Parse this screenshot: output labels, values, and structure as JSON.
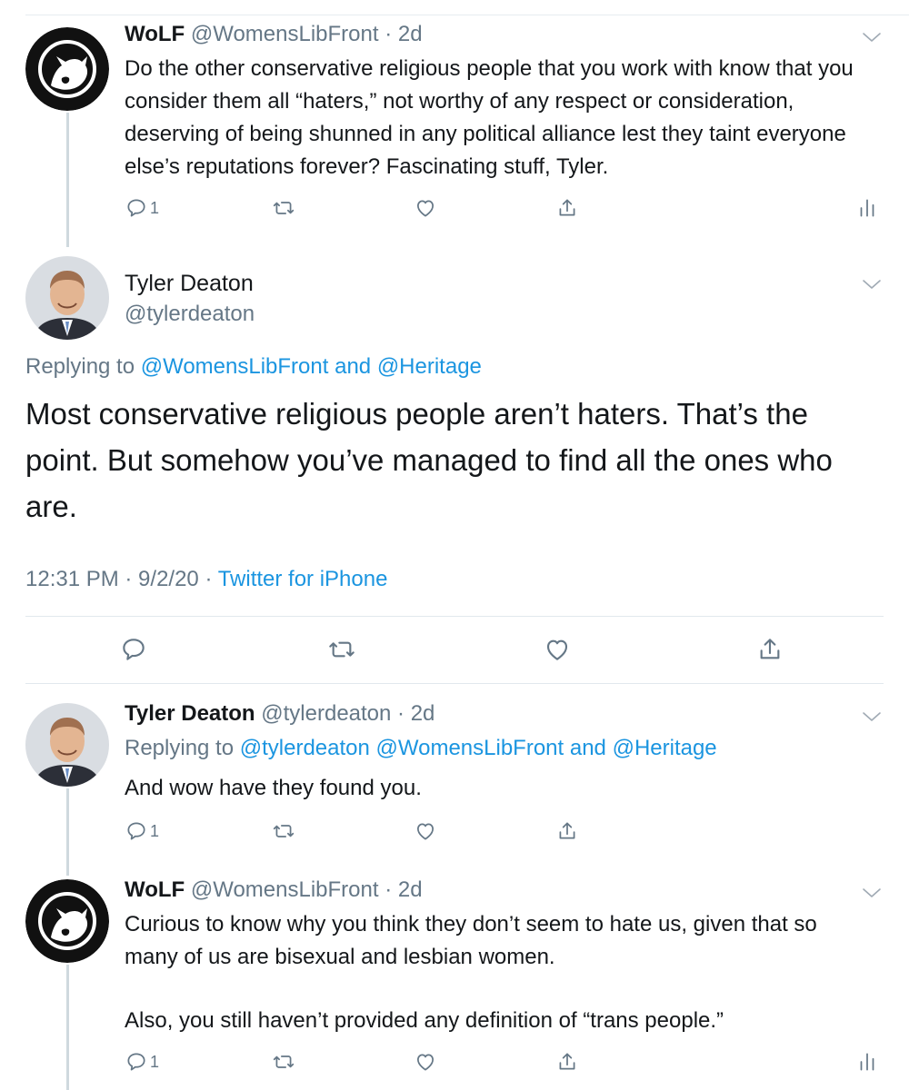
{
  "tweet1": {
    "name": "WoLF",
    "meta": "@WomensLibFront · 2d",
    "text": "Do the other conservative religious people that you work with know that you consider them all “haters,” not worthy of any respect or consideration, deserving of being shunned in any political alliance lest they taint everyone else’s reputations forever? Fascinating stuff, Tyler.",
    "reply_count": "1"
  },
  "main": {
    "name": "Tyler Deaton",
    "handle": "@tylerdeaton",
    "replying_prefix": "Replying to",
    "replying_to_1": "@WomensLibFront",
    "replying_and": "and",
    "replying_to_2": "@Heritage",
    "text": "Most conservative religious people aren’t haters. That’s the point. But somehow you’ve managed to find all the ones who are.",
    "time": "12:31 PM · 9/2/20 ·",
    "source": "Twitter for iPhone"
  },
  "tweet3": {
    "name": "Tyler Deaton",
    "meta": "@tylerdeaton · 2d",
    "replying_prefix": "Replying to",
    "replying_to": "@tylerdeaton @WomensLibFront",
    "replying_and": "and",
    "replying_to_2": "@Heritage",
    "text": "And wow have they found you.",
    "reply_count": "1"
  },
  "tweet4": {
    "name": "WoLF",
    "meta": "@WomensLibFront · 2d",
    "para1": "Curious to know why you think they don’t seem to hate us, given that so many of us are bisexual and lesbian women.",
    "para2": "Also, you still haven’t provided any definition of “trans people.”",
    "reply_count": "1"
  },
  "colors": {
    "link": "#1b95e0",
    "muted": "#657786",
    "text": "#14171a",
    "line": "#cfd9de"
  },
  "icons": [
    "reply-icon",
    "retweet-icon",
    "like-icon",
    "share-icon",
    "analytics-icon",
    "chevron-down-icon",
    "wolf-logo-avatar",
    "person-avatar"
  ]
}
